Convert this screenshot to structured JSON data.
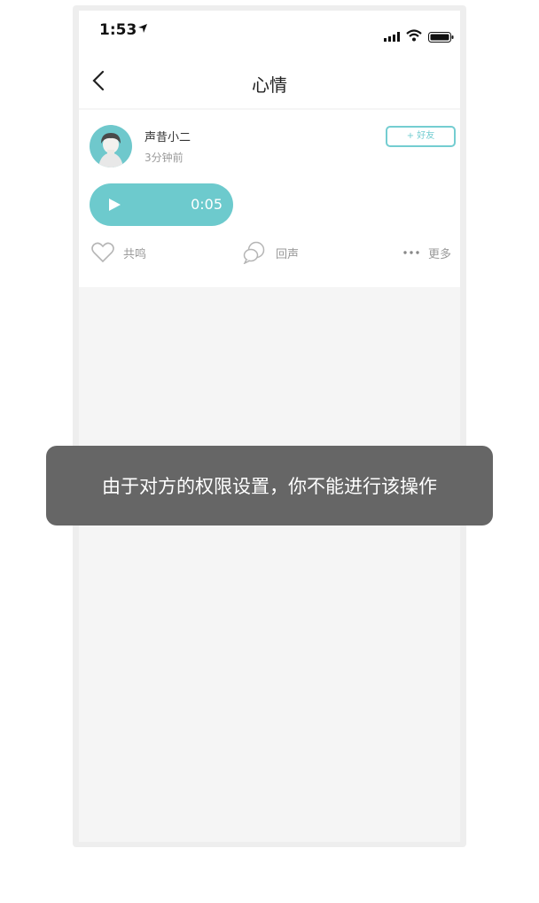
{
  "status_bar": {
    "time": "1:53"
  },
  "nav": {
    "title": "心情"
  },
  "post": {
    "username": "声昔小二",
    "time_ago": "3分钟前",
    "add_friend_label": "+ 好友",
    "voice_duration": "0:05",
    "actions": {
      "resonate": "共鸣",
      "echo": "回声",
      "more": "更多"
    }
  },
  "toast": {
    "message": "由于对方的权限设置，你不能进行该操作"
  },
  "colors": {
    "accent": "#6dcacd",
    "toast_bg": "#666666",
    "background": "#f5f5f5"
  }
}
